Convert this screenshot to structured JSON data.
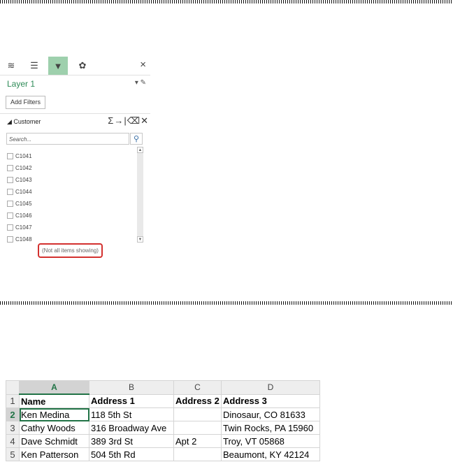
{
  "panel": {
    "tabs": [
      {
        "icon": "layers-icon",
        "glyph": "≋"
      },
      {
        "icon": "list-options-icon",
        "glyph": "☰"
      },
      {
        "icon": "filter-icon",
        "glyph": "▼",
        "active": true
      },
      {
        "icon": "settings-gear-icon",
        "glyph": "✿"
      }
    ],
    "close_glyph": "×",
    "layer_name": "Layer 1",
    "layer_controls": "▾ ✎",
    "add_filters_label": "Add Filters",
    "field_name": "◢ Customer",
    "field_controls": "Σ→|⌫✕",
    "search_placeholder": "Search...",
    "search_glyph": "⚲",
    "items": [
      "C1041",
      "C1042",
      "C1043",
      "C1044",
      "C1045",
      "C1046",
      "C1047",
      "C1048"
    ],
    "not_all_showing": "(Not all items showing)"
  },
  "sheet": {
    "columns": [
      "A",
      "B",
      "C",
      "D"
    ],
    "rows": [
      {
        "num": "1",
        "cells": [
          "Name",
          "Address 1",
          "Address 2",
          "Address 3"
        ]
      },
      {
        "num": "2",
        "cells": [
          "Ken Medina",
          "118 5th  St",
          "",
          "Dinosaur, CO 81633"
        ]
      },
      {
        "num": "3",
        "cells": [
          "Cathy Woods",
          "316 Broadway Ave",
          "",
          "Twin Rocks, PA 15960"
        ]
      },
      {
        "num": "4",
        "cells": [
          "Dave Schmidt",
          "389 3rd  St",
          "Apt 2",
          "Troy, VT 05868"
        ]
      },
      {
        "num": "5",
        "cells": [
          "Ken Patterson",
          "504 5th  Rd",
          "",
          "Beaumont, KY 42124"
        ]
      }
    ],
    "accent": "#217346"
  }
}
